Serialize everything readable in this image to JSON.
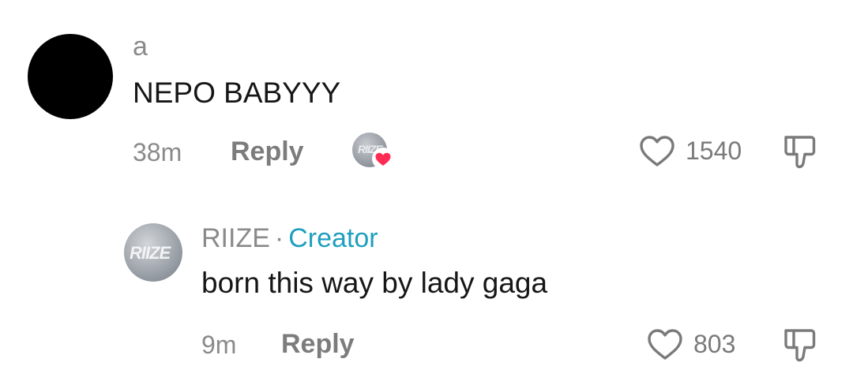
{
  "comment": {
    "username": "a",
    "text": "NEPO BABYYY",
    "time": "38m",
    "reply_label": "Reply",
    "creator_avatar_text": "RIIZE",
    "like_count": "1540"
  },
  "reply": {
    "username": "RIIZE",
    "separator": "·",
    "creator_badge": "Creator",
    "avatar_text": "RIIZE",
    "text": "born this way by lady gaga",
    "time": "9m",
    "reply_label": "Reply",
    "like_count": "803"
  },
  "colors": {
    "creator": "#1e9fbf",
    "heart_badge": "#fe2c55",
    "muted_text": "#8a8a8a",
    "body_text": "#161616"
  }
}
